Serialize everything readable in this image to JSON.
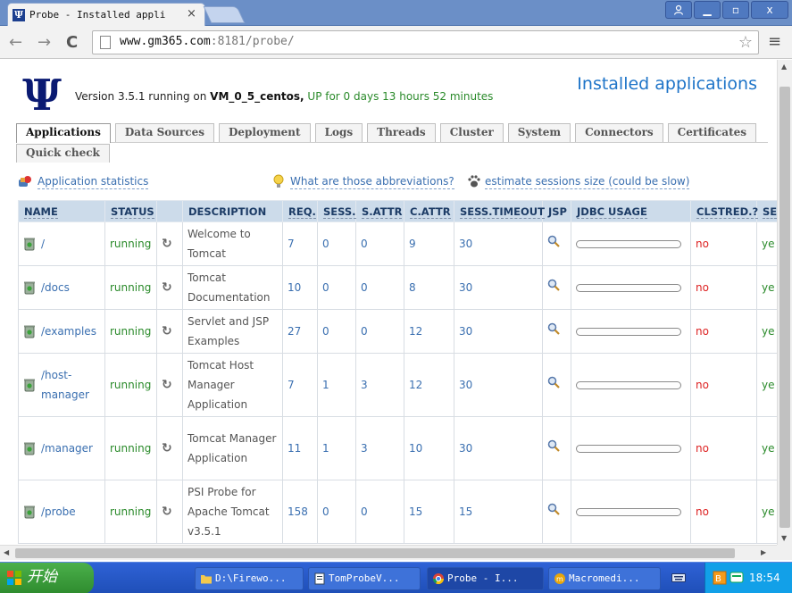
{
  "browser": {
    "tab_title": "Probe - Installed appli",
    "tab_close": "×",
    "url_host": "www.gm365.com",
    "url_rest": ":8181/probe/",
    "win_min": "▁",
    "win_max": "▫",
    "win_close": "x"
  },
  "header": {
    "version_prefix": "Version 3.5.1 running on ",
    "server": "VM_0_5_centos,",
    "uptime": "UP for 0 days 13 hours 52 minutes",
    "title": "Installed applications"
  },
  "tabs": {
    "row1": [
      "Applications",
      "Data Sources",
      "Deployment",
      "Logs",
      "Threads",
      "Cluster",
      "System",
      "Connectors",
      "Certificates"
    ],
    "row2": [
      "Quick check"
    ],
    "active": "Applications"
  },
  "links": {
    "stats": "Application statistics",
    "abbrev": "What are those abbreviations?",
    "size": "estimate sessions size (could be slow)"
  },
  "table": {
    "headers": {
      "name": "NAME",
      "status": "STATUS",
      "description": "DESCRIPTION",
      "req": "REQ.",
      "sess": "SESS.",
      "sattr": "S.ATTR",
      "cattr": "C.ATTR",
      "timeout": "SESS.TIMEOUT",
      "jsp": "JSP",
      "jdbc": "JDBC USAGE",
      "clstred": "CLSTRED.?",
      "serializable": "SE"
    },
    "rows": [
      {
        "name": "/",
        "status": "running",
        "description": "Welcome to Tomcat",
        "req": "7",
        "sess": "0",
        "sattr": "0",
        "cattr": "9",
        "timeout": "30",
        "jdbc_usage": 0,
        "clstred": "no",
        "serializable": "ye"
      },
      {
        "name": "/docs",
        "status": "running",
        "description": "Tomcat Documentation",
        "req": "10",
        "sess": "0",
        "sattr": "0",
        "cattr": "8",
        "timeout": "30",
        "jdbc_usage": 0,
        "clstred": "no",
        "serializable": "ye"
      },
      {
        "name": "/examples",
        "status": "running",
        "description": "Servlet and JSP Examples",
        "req": "27",
        "sess": "0",
        "sattr": "0",
        "cattr": "12",
        "timeout": "30",
        "jdbc_usage": 0,
        "clstred": "no",
        "serializable": "ye"
      },
      {
        "name": "/host-manager",
        "status": "running",
        "description": "Tomcat Host Manager Application",
        "req": "7",
        "sess": "1",
        "sattr": "3",
        "cattr": "12",
        "timeout": "30",
        "jdbc_usage": 0,
        "clstred": "no",
        "serializable": "ye"
      },
      {
        "name": "/manager",
        "status": "running",
        "description": "Tomcat Manager Application",
        "req": "11",
        "sess": "1",
        "sattr": "3",
        "cattr": "10",
        "timeout": "30",
        "jdbc_usage": 0,
        "clstred": "no",
        "serializable": "ye"
      },
      {
        "name": "/probe",
        "status": "running",
        "description": "PSI Probe for Apache Tomcat v3.5.1",
        "req": "158",
        "sess": "0",
        "sattr": "0",
        "cattr": "15",
        "timeout": "15",
        "jdbc_usage": 0,
        "clstred": "no",
        "serializable": "ye"
      }
    ]
  },
  "taskbar": {
    "start": "开始",
    "tasks": [
      "D:\\Firewo...",
      "TomProbeV...",
      "Probe - I...",
      "Macromedi..."
    ],
    "clock": "18:54"
  },
  "colors": {
    "accent": "#1e74c8",
    "running": "#2a8a2a",
    "no": "#d22222",
    "header_bg": "#ccdbea"
  }
}
